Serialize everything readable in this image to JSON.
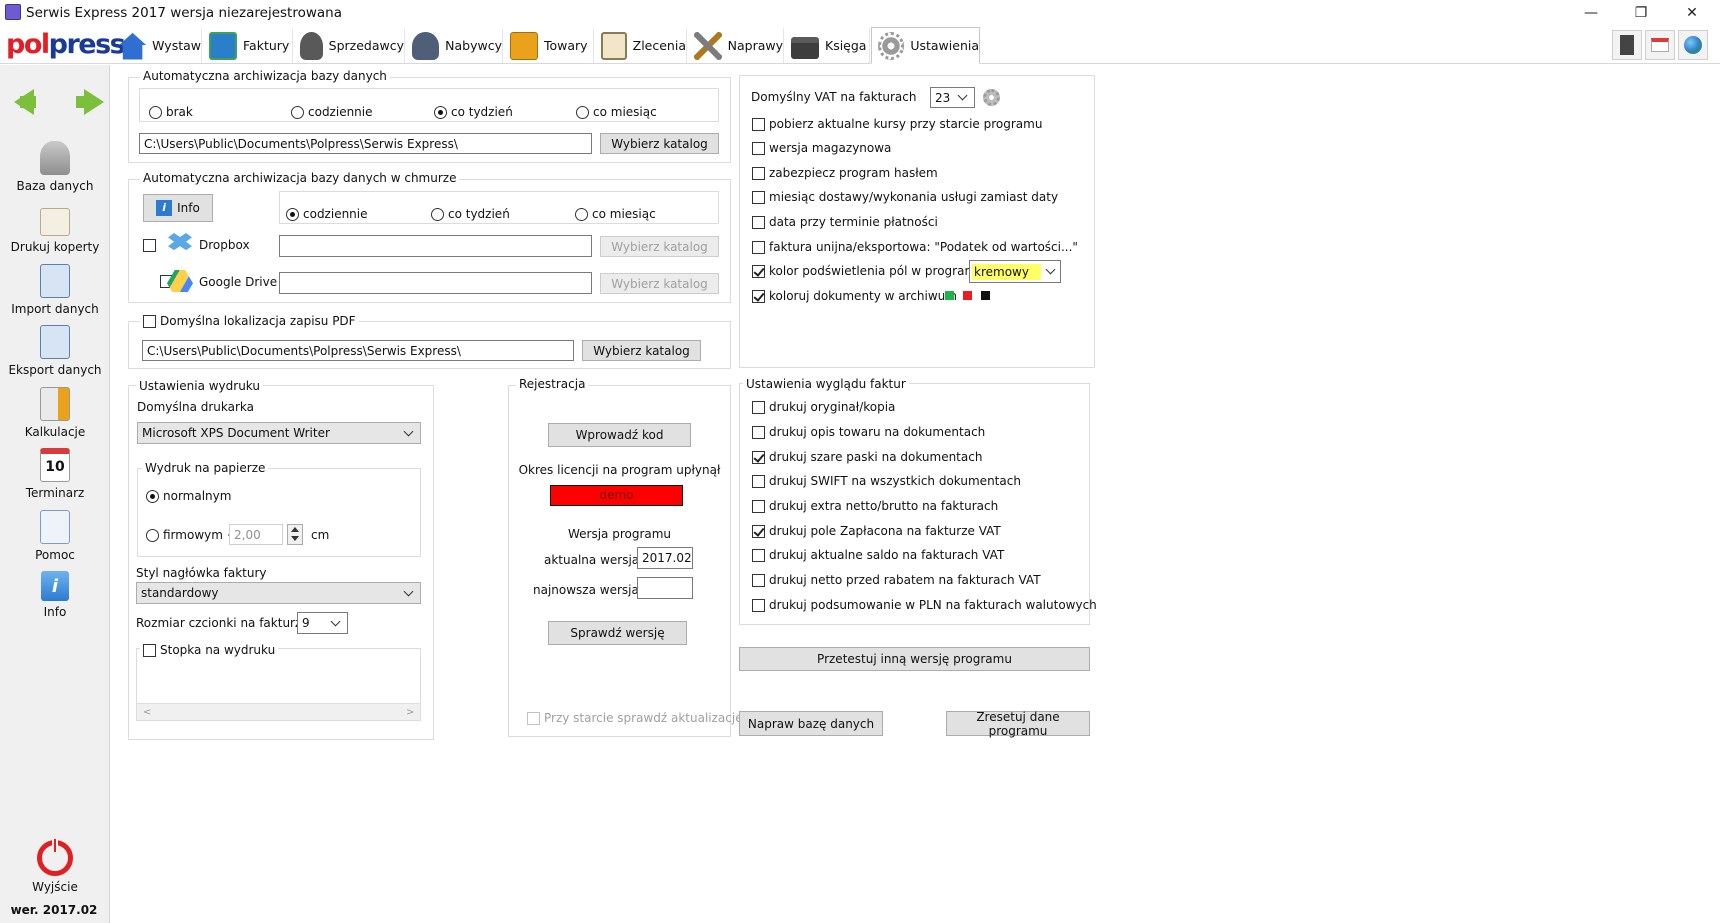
{
  "window": {
    "title": "Serwis Express 2017 wersja niezarejestrowana"
  },
  "logo": {
    "part1": "pol",
    "part2": "press"
  },
  "tabs": [
    {
      "label": "Wystaw"
    },
    {
      "label": "Faktury"
    },
    {
      "label": "Sprzedawcy"
    },
    {
      "label": "Nabywcy"
    },
    {
      "label": "Towary"
    },
    {
      "label": "Zlecenia"
    },
    {
      "label": "Naprawy"
    },
    {
      "label": "Księga"
    },
    {
      "label": "Ustawienia"
    }
  ],
  "sidebar": {
    "items": [
      {
        "label": "Baza danych"
      },
      {
        "label": "Drukuj koperty"
      },
      {
        "label": "Import danych"
      },
      {
        "label": "Eksport danych"
      },
      {
        "label": "Kalkulacje"
      },
      {
        "label": "Terminarz"
      },
      {
        "label": "Pomoc"
      },
      {
        "label": "Info"
      }
    ],
    "calendar_day": "10",
    "exit_label": "Wyjście",
    "version": "wer. 2017.02"
  },
  "archive": {
    "title": "Automatyczna archiwizacja bazy danych",
    "options": [
      "brak",
      "codziennie",
      "co tydzień",
      "co miesiąc"
    ],
    "path": "C:\\Users\\Public\\Documents\\Polpress\\Serwis Express\\",
    "choose_label": "Wybierz katalog"
  },
  "cloud": {
    "title": "Automatyczna archiwizacja bazy danych w chmurze",
    "info_label": "Info",
    "options": [
      "codziennie",
      "co tydzień",
      "co miesiąc"
    ],
    "dropbox_label": "Dropbox",
    "gdrive_label": "Google Drive",
    "choose_label": "Wybierz katalog"
  },
  "pdf": {
    "title": "Domyślna lokalizacja zapisu PDF",
    "path": "C:\\Users\\Public\\Documents\\Polpress\\Serwis Express\\",
    "choose_label": "Wybierz katalog"
  },
  "print": {
    "title": "Ustawienia wydruku",
    "printer_label": "Domyślna drukarka",
    "printer_value": "Microsoft XPS Document Writer",
    "paper_title": "Wydruk na papierze",
    "normal_label": "normalnym",
    "company_label": "firmowym +",
    "company_value": "2,00",
    "unit": "cm",
    "header_style_label": "Styl nagłówka faktury",
    "header_style_value": "standardowy",
    "font_size_label": "Rozmiar czcionki na fakturze",
    "font_size_value": "9",
    "footer_label": "Stopka na wydruku"
  },
  "registration": {
    "title": "Rejestracja",
    "enter_code_label": "Wprowadź kod",
    "license_text": "Okres licencji na program upłynął",
    "status": "demo",
    "version_title": "Wersja programu",
    "current_label": "aktualna wersja",
    "current_value": "2017.02",
    "newest_label": "najnowsza wersja",
    "newest_value": "",
    "check_label": "Sprawdź wersję",
    "startup_check_label": "Przy starcie sprawdź aktualizacje"
  },
  "general": {
    "vat_label": "Domyślny VAT na fakturach",
    "vat_value": "23",
    "options": [
      {
        "label": "pobierz aktualne kursy przy starcie programu",
        "checked": false
      },
      {
        "label": "wersja magazynowa",
        "checked": false
      },
      {
        "label": "zabezpiecz program hasłem",
        "checked": false
      },
      {
        "label": "miesiąc dostawy/wykonania usługi zamiast daty",
        "checked": false
      },
      {
        "label": "data przy terminie płatności",
        "checked": false
      },
      {
        "label": "faktura unijna/eksportowa: \"Podatek od wartości...\"",
        "checked": false
      },
      {
        "label": "kolor podświetlenia pól w programie",
        "checked": true
      },
      {
        "label": "koloruj dokumenty w archiwum",
        "checked": true
      }
    ],
    "highlight_color_value": "kremowy",
    "highlight_color_hex": "#ffff66",
    "archive_colors": [
      "#22b14c",
      "#e81d23",
      "#111111"
    ]
  },
  "invoice_look": {
    "title": "Ustawienia wyglądu faktur",
    "options": [
      {
        "label": "drukuj oryginał/kopia",
        "checked": false
      },
      {
        "label": "drukuj opis towaru na dokumentach",
        "checked": false
      },
      {
        "label": "drukuj szare paski na dokumentach",
        "checked": true
      },
      {
        "label": "drukuj SWIFT na wszystkich dokumentach",
        "checked": false
      },
      {
        "label": "drukuj extra netto/brutto na fakturach",
        "checked": false
      },
      {
        "label": "drukuj pole Zapłacona na fakturze VAT",
        "checked": true
      },
      {
        "label": "drukuj aktualne saldo na fakturach VAT",
        "checked": false
      },
      {
        "label": "drukuj netto przed rabatem na fakturach VAT",
        "checked": false
      },
      {
        "label": "drukuj podsumowanie w PLN na fakturach walutowych",
        "checked": false
      }
    ]
  },
  "actions": {
    "test_label": "Przetestuj inną wersję programu",
    "repair_label": "Napraw bazę danych",
    "reset_label": "Zresetuj dane programu"
  },
  "colors": {
    "demo_red": "#ff0000",
    "accent_blue": "#1a3b95",
    "logo_red": "#e31e26"
  }
}
